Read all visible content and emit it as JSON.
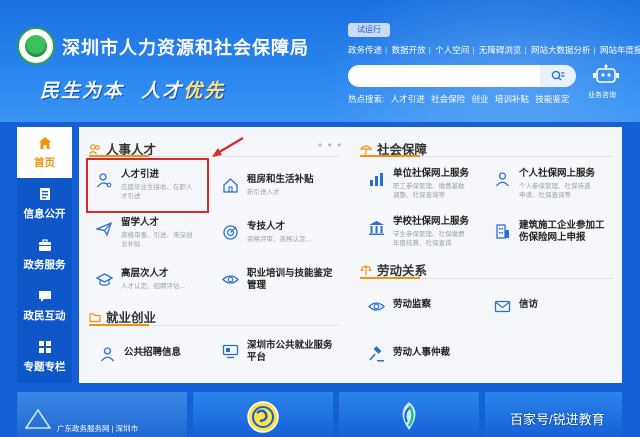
{
  "header": {
    "site_title": "深圳市人力资源和社会保障局",
    "slogan_part1": "民生为本",
    "slogan_part2": "人才",
    "slogan_part3": "优先",
    "trial_badge": "试运行",
    "top_links": [
      "政务传递",
      "数据开放",
      "个人空间",
      "无障碍浏览",
      "网站大数据分析",
      "网站年度报表"
    ],
    "search": {
      "value": "",
      "placeholder": ""
    },
    "hot_label": "热点搜索:",
    "hot_terms": [
      "人才引进",
      "社会保险",
      "创业",
      "培训补贴",
      "技能鉴定"
    ],
    "assistant_label": "业务咨询"
  },
  "sidebar": {
    "items": [
      {
        "label": "首页",
        "icon": "home-icon",
        "active": true
      },
      {
        "label": "信息公开",
        "icon": "document-icon",
        "active": false
      },
      {
        "label": "政务服务",
        "icon": "briefcase-icon",
        "active": false
      },
      {
        "label": "政民互动",
        "icon": "chat-icon",
        "active": false
      },
      {
        "label": "专题专栏",
        "icon": "grid-icon",
        "active": false
      }
    ]
  },
  "sections": {
    "talent": {
      "title": "人事人才",
      "items": [
        {
          "title": "人才引进",
          "desc1": "应届毕业生接收、在职人",
          "desc2": "才引进"
        },
        {
          "title": "租房和生活补贴",
          "desc1": "新引进人才",
          "desc2": ""
        },
        {
          "title": "留学人才",
          "desc1": "资格审查、引进、来深创",
          "desc2": "业补贴"
        },
        {
          "title": "专技人才",
          "desc1": "资格评审、资格认定...",
          "desc2": ""
        },
        {
          "title": "高层次人才",
          "desc1": "人才认定、招聘评估...",
          "desc2": ""
        },
        {
          "title": "职业培训与技能鉴定",
          "title2": "管理",
          "desc1": "",
          "desc2": ""
        }
      ]
    },
    "social": {
      "title": "社会保障",
      "items": [
        {
          "title": "单位社保网上服务",
          "desc1": "职工参保管理、缴费基数",
          "desc2": "调整、社保查询等"
        },
        {
          "title": "个人社保网上服务",
          "desc1": "个人参保管理、社保待遇",
          "desc2": "申请、社保查询等"
        },
        {
          "title": "学校社保网上服务",
          "desc1": "学生参保管理、社保缴费",
          "desc2": "年度结算、社保查询"
        },
        {
          "title": "建筑施工企业参加工",
          "title2": "伤保险网上申报",
          "desc1": "",
          "desc2": ""
        }
      ]
    },
    "employment": {
      "title": "就业创业",
      "items": [
        {
          "title": "公共招聘信息"
        },
        {
          "title": "深圳市公共就业服务",
          "title2": "平台"
        }
      ]
    },
    "labor": {
      "title": "劳动关系",
      "items": [
        {
          "title": "劳动监察"
        },
        {
          "title": "信访"
        },
        {
          "title": "劳动人事仲裁"
        }
      ]
    },
    "more_dots": "• • •"
  },
  "bottom": {
    "tile1_text": "广东政务服务网  |  深圳市",
    "watermark": "百家号/锐进教育"
  },
  "colors": {
    "accent": "#f29211",
    "brand_blue": "#1560d6",
    "highlight_red": "#d52b2b"
  }
}
